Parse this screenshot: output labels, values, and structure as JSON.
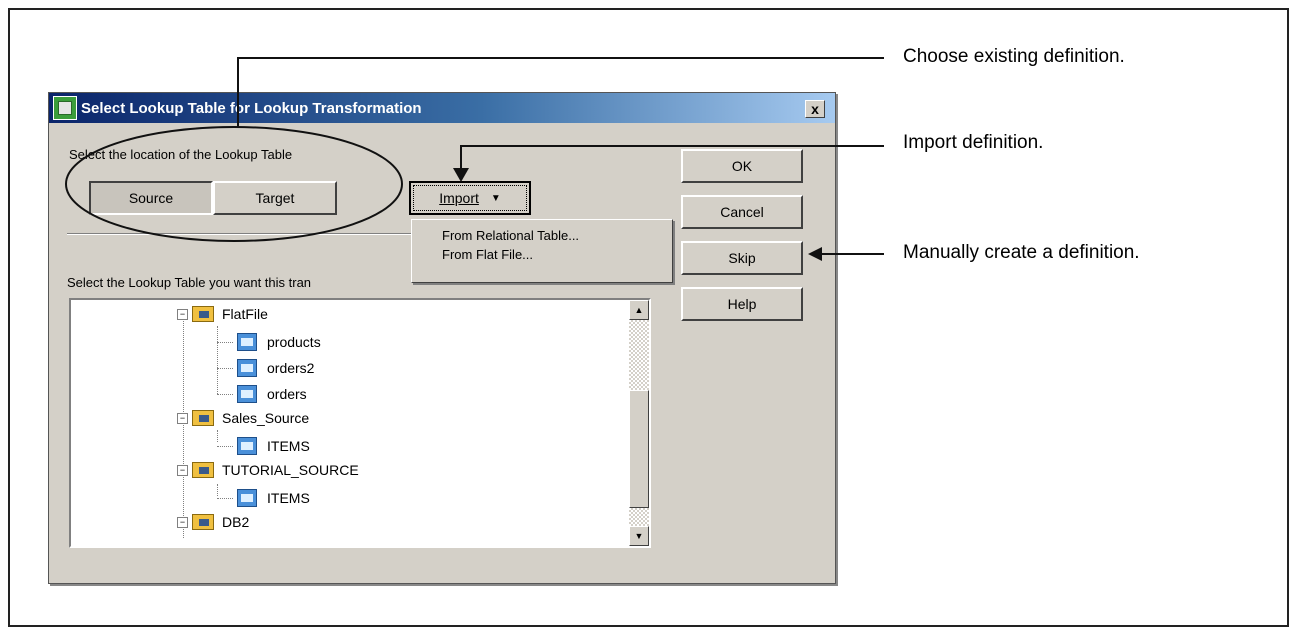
{
  "dialog": {
    "title": "Select Lookup Table for Lookup Transformation",
    "close_label": "x",
    "location_label": "Select the location of the Lookup Table",
    "source_label": "Source",
    "target_label": "Target",
    "selected_location": "Source",
    "import_label": "Import",
    "ok_label": "OK",
    "cancel_label": "Cancel",
    "skip_label": "Skip",
    "help_label": "Help",
    "table_prompt": "Select the Lookup Table you want this tran",
    "import_menu": [
      "From Relational Table...",
      "From Flat File..."
    ]
  },
  "tree": {
    "folders": [
      {
        "label": "FlatFile",
        "items": [
          "products",
          "orders2",
          "orders"
        ]
      },
      {
        "label": "Sales_Source",
        "items": [
          "ITEMS"
        ]
      },
      {
        "label": "TUTORIAL_SOURCE",
        "items": [
          "ITEMS"
        ]
      },
      {
        "label": "DB2",
        "items": []
      }
    ]
  },
  "annotations": {
    "existing": "Choose existing definition.",
    "import": "Import definition.",
    "manual": "Manually create a definition."
  }
}
